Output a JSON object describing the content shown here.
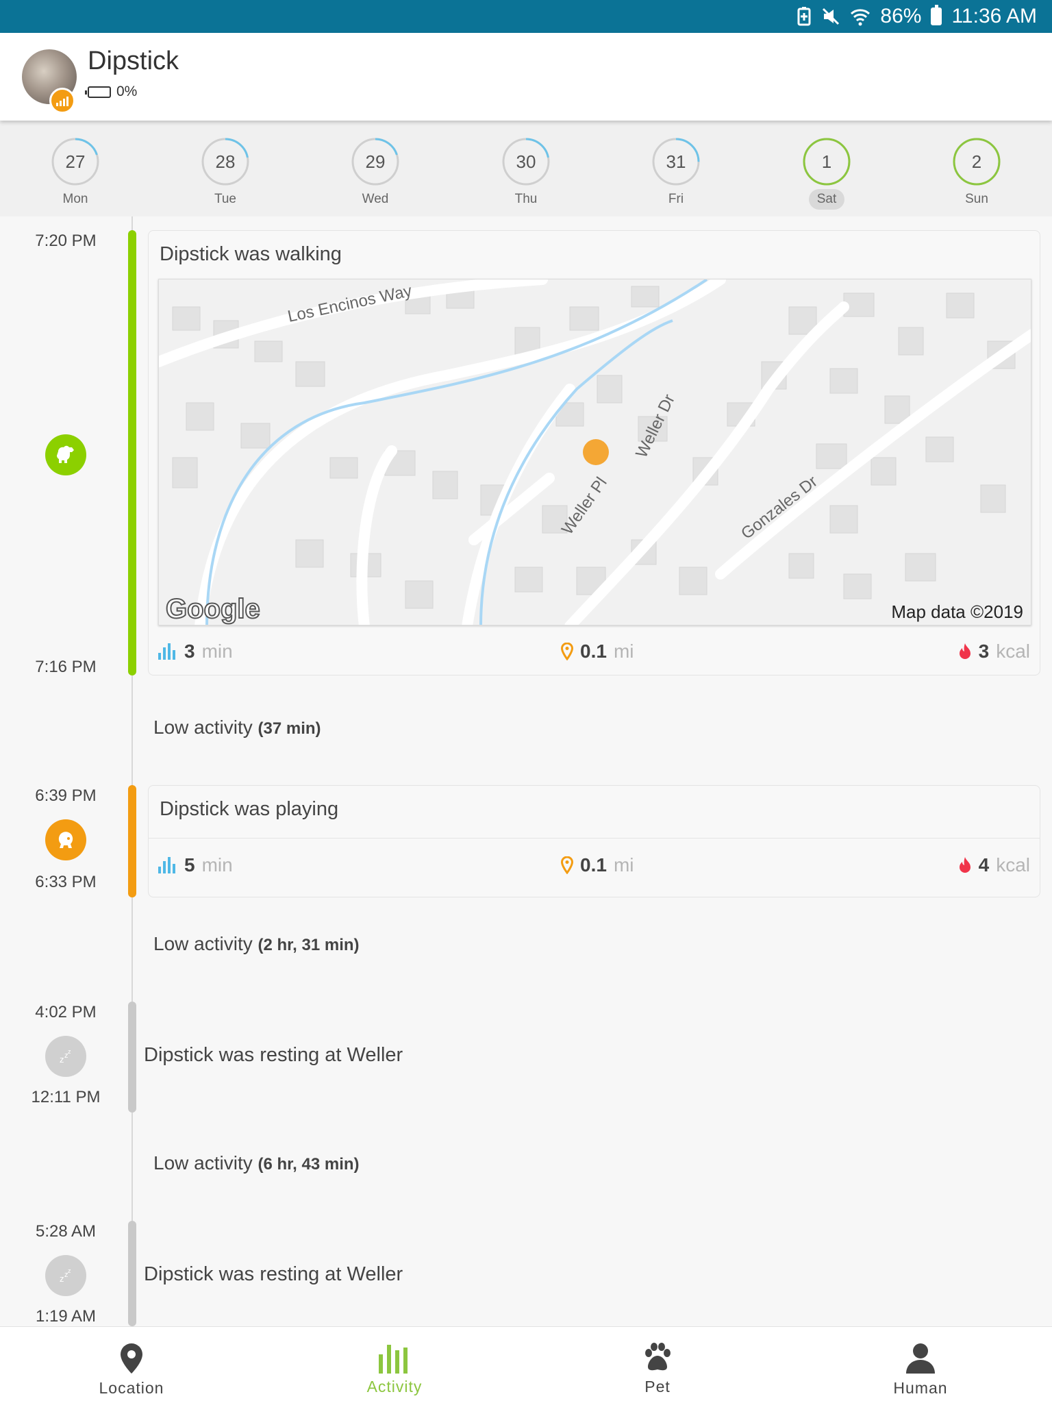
{
  "status_bar": {
    "battery": "86%",
    "time": "11:36 AM"
  },
  "pet": {
    "name": "Dipstick",
    "battery": "0%"
  },
  "week": [
    {
      "num": "27",
      "day": "Mon",
      "progress": 0.2
    },
    {
      "num": "28",
      "day": "Tue",
      "progress": 0.22
    },
    {
      "num": "29",
      "day": "Wed",
      "progress": 0.2
    },
    {
      "num": "30",
      "day": "Thu",
      "progress": 0.22
    },
    {
      "num": "31",
      "day": "Fri",
      "progress": 0.25
    },
    {
      "num": "1",
      "day": "Sat",
      "progress": 1.0,
      "selected": true
    },
    {
      "num": "2",
      "day": "Sun",
      "progress": 1.0
    }
  ],
  "events": {
    "walk": {
      "start": "7:20 PM",
      "end": "7:16 PM",
      "title": "Dipstick was walking",
      "map": {
        "streets": [
          "Los Encinos Way",
          "Weller Dr",
          "Weller Pl",
          "Gonzales Dr"
        ],
        "attribution": "Map data ©2019",
        "logo": "Google"
      },
      "duration": "3",
      "duration_unit": "min",
      "distance": "0.1",
      "distance_unit": "mi",
      "calories": "3",
      "calories_unit": "kcal"
    },
    "low1": {
      "label": "Low activity",
      "value": "(37 min)"
    },
    "play": {
      "start": "6:39 PM",
      "end": "6:33 PM",
      "title": "Dipstick was playing",
      "duration": "5",
      "duration_unit": "min",
      "distance": "0.1",
      "distance_unit": "mi",
      "calories": "4",
      "calories_unit": "kcal"
    },
    "low2": {
      "label": "Low activity",
      "value": "(2 hr, 31 min)"
    },
    "rest1": {
      "start": "4:02 PM",
      "end": "12:11 PM",
      "title": "Dipstick was resting at Weller"
    },
    "low3": {
      "label": "Low activity",
      "value": "(6 hr, 43 min)"
    },
    "rest2": {
      "start": "5:28 AM",
      "end": "1:19 AM",
      "title": "Dipstick was resting at Weller"
    }
  },
  "nav": [
    {
      "label": "Location",
      "icon": "location-pin-icon"
    },
    {
      "label": "Activity",
      "icon": "activity-bars-icon",
      "active": true
    },
    {
      "label": "Pet",
      "icon": "paw-icon"
    },
    {
      "label": "Human",
      "icon": "person-icon"
    }
  ],
  "colors": {
    "walk": "#8cd000",
    "play": "#f39c12",
    "rest": "#c9c9c9",
    "accent": "#8cc63f",
    "ring": "#6ec3e8",
    "statusbar": "#0b7396"
  }
}
